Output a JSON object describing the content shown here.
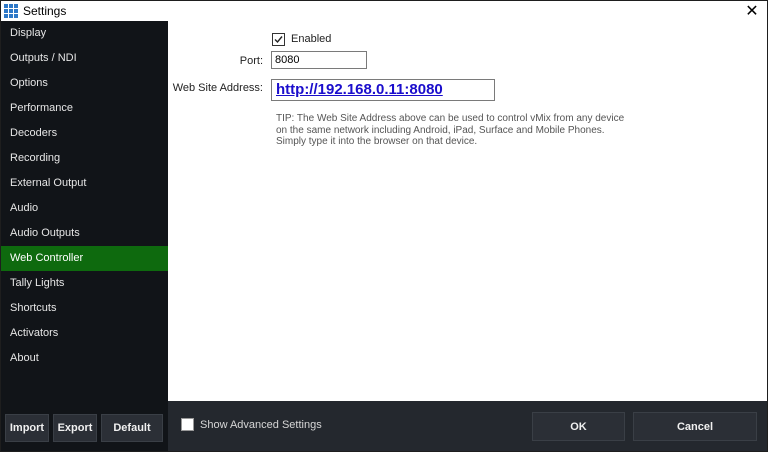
{
  "window": {
    "title": "Settings"
  },
  "sidebar": {
    "items": [
      {
        "label": "Display"
      },
      {
        "label": "Outputs / NDI"
      },
      {
        "label": "Options"
      },
      {
        "label": "Performance"
      },
      {
        "label": "Decoders"
      },
      {
        "label": "Recording"
      },
      {
        "label": "External Output"
      },
      {
        "label": "Audio"
      },
      {
        "label": "Audio Outputs"
      },
      {
        "label": "Web Controller",
        "active": true
      },
      {
        "label": "Tally Lights"
      },
      {
        "label": "Shortcuts"
      },
      {
        "label": "Activators"
      },
      {
        "label": "About"
      }
    ],
    "buttons": {
      "import": "Import",
      "export": "Export",
      "default": "Default"
    }
  },
  "web_controller": {
    "enabled_label": "Enabled",
    "enabled_checked": true,
    "port_label": "Port:",
    "port_value": "8080",
    "web_address_label": "Web Site Address:",
    "web_address": "http://192.168.0.11:8080",
    "tip_line1": "TIP: The Web Site Address above can be used to control vMix from any device",
    "tip_line2": "on the same network including Android, iPad, Surface and Mobile Phones.",
    "tip_line3": "Simply type it into the browser on that device."
  },
  "footer": {
    "advanced_label": "Show Advanced Settings",
    "advanced_checked": false,
    "ok": "OK",
    "cancel": "Cancel"
  },
  "colors": {
    "sidebar_bg": "#111418",
    "active_item": "#0e6a0e",
    "footer_bg": "#24282e",
    "link": "#1a0dcc"
  }
}
